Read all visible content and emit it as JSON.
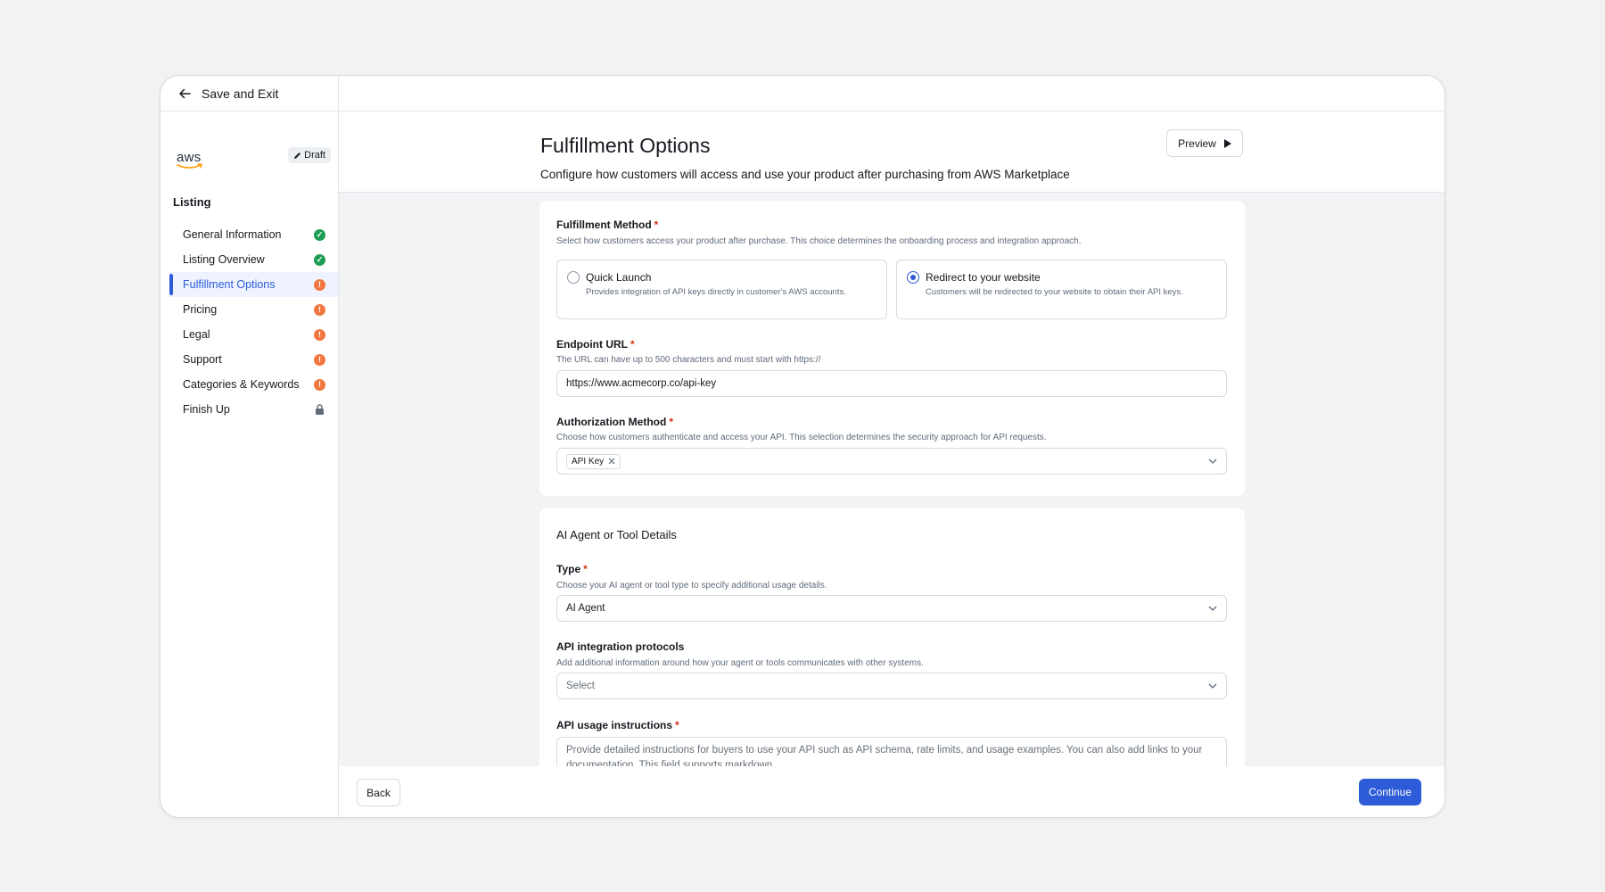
{
  "sidebar": {
    "save_exit": "Save and Exit",
    "logo_text": "aws",
    "draft_label": "Draft",
    "section_title": "Listing",
    "items": [
      {
        "label": "General Information",
        "status": "complete"
      },
      {
        "label": "Listing Overview",
        "status": "complete"
      },
      {
        "label": "Fulfillment Options",
        "status": "warning",
        "active": true
      },
      {
        "label": "Pricing",
        "status": "warning"
      },
      {
        "label": "Legal",
        "status": "warning"
      },
      {
        "label": "Support",
        "status": "warning"
      },
      {
        "label": "Categories & Keywords",
        "status": "warning"
      },
      {
        "label": "Finish Up",
        "status": "locked"
      }
    ]
  },
  "header": {
    "title": "Fulfillment Options",
    "description": "Configure how customers will access and use your product after purchasing from AWS Marketplace",
    "preview_label": "Preview"
  },
  "fulfillment": {
    "method_label": "Fulfillment Method",
    "method_help": "Select how customers access your product after purchase. This choice determines the onboarding process and integration approach.",
    "options": [
      {
        "title": "Quick Launch",
        "desc": "Provides integration of API keys directly in customer's AWS accounts.",
        "selected": false
      },
      {
        "title": "Redirect to your website",
        "desc": "Customers will be redirected to your website to obtain their API keys.",
        "selected": true
      }
    ],
    "endpoint_label": "Endpoint URL",
    "endpoint_help": "The URL can have up to 500 characters and must start with https://",
    "endpoint_value": "https://www.acmecorp.co/api-key",
    "auth_label": "Authorization Method",
    "auth_help": "Choose how customers authenticate and access your API. This selection determines the security approach for API requests.",
    "auth_token": "API Key"
  },
  "agent": {
    "section_title": "AI Agent or Tool Details",
    "type_label": "Type",
    "type_help": "Choose your AI agent or tool type to specify additional usage details.",
    "type_value": "AI Agent",
    "protocols_label": "API integration protocols",
    "protocols_help": "Add additional information around how your agent or tools communicates with other systems.",
    "protocols_placeholder": "Select",
    "usage_label": "API usage instructions",
    "usage_placeholder": "Provide detailed instructions for buyers to use your API such as API schema, rate limits, and usage examples. You can also add links to your documentation. This field supports markdown."
  },
  "footer": {
    "back_label": "Back",
    "continue_label": "Continue"
  },
  "colors": {
    "accent": "#2e5bd7",
    "complete": "#1d9e57",
    "warning": "#f2773f",
    "required": "#d13212"
  },
  "icons": [
    "back-arrow-icon",
    "pencil-icon",
    "check-circle-icon",
    "warning-circle-icon",
    "lock-icon",
    "play-icon",
    "close-icon",
    "chevron-down-icon"
  ]
}
